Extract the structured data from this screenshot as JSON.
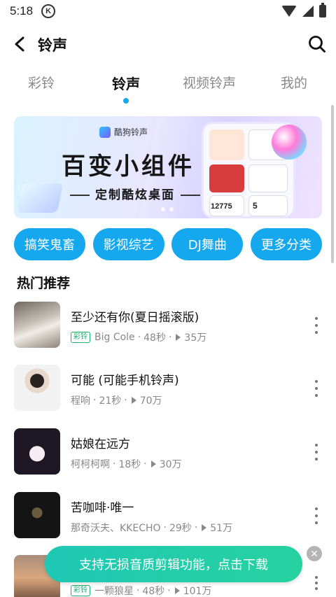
{
  "status_bar": {
    "time": "5:18",
    "app_badge": "K"
  },
  "header": {
    "title": "铃声"
  },
  "tabs": [
    {
      "label": "彩铃",
      "active": false
    },
    {
      "label": "铃声",
      "active": true
    },
    {
      "label": "视频铃声",
      "active": false
    },
    {
      "label": "我的",
      "active": false
    }
  ],
  "banner": {
    "logo_text": "酷狗铃声",
    "title": "百变小组件",
    "subtitle": "定制酷炫桌面",
    "widget_number": "12775",
    "widget_number2": "5",
    "accent_color": "#15a8ef"
  },
  "categories": [
    "搞笑鬼畜",
    "影视综艺",
    "DJ舞曲",
    "更多分类"
  ],
  "section_title": "热门推荐",
  "songs": [
    {
      "title": "至少还有你(夏日摇滚版)",
      "tag": "彩铃",
      "artist": "Big Cole",
      "duration": "48秒",
      "plays": "35万"
    },
    {
      "title": "可能 (可能手机铃声)",
      "tag": "",
      "artist": "程响",
      "duration": "21秒",
      "plays": "70万"
    },
    {
      "title": "姑娘在远方",
      "tag": "",
      "artist": "柯柯柯啊",
      "duration": "18秒",
      "plays": "30万"
    },
    {
      "title": "苦咖啡·唯一",
      "tag": "",
      "artist": "那奇沃夫、KKECHO",
      "duration": "29秒",
      "plays": "51万"
    },
    {
      "title": "",
      "tag": "彩铃",
      "artist": "一颗狼星",
      "duration": "48秒",
      "plays": "101万"
    }
  ],
  "toast": {
    "text": "支持无损音质剪辑功能，点击下载",
    "close_symbol": "✕"
  }
}
